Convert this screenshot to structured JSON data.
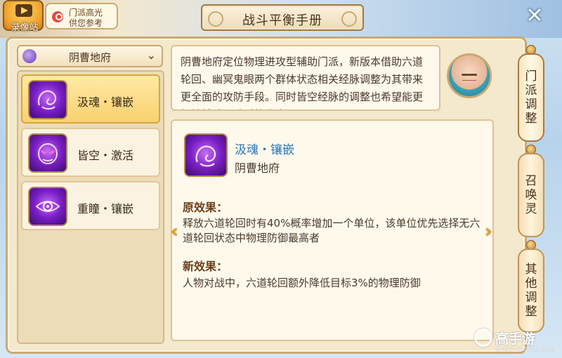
{
  "header": {
    "record_label": "录像站",
    "highlight_line1": "门派高光",
    "highlight_line2": "供您参考",
    "title": "战斗平衡手册",
    "close_symbol": "✕"
  },
  "school_select": {
    "label": "阴曹地府",
    "arrow": "⌄"
  },
  "skills": [
    {
      "name": "汲魂・镶嵌",
      "selected": true,
      "icon": "ghost-swirl-icon"
    },
    {
      "name": "皆空・激活",
      "selected": false,
      "icon": "demon-mask-icon"
    },
    {
      "name": "重瞳・镶嵌",
      "selected": false,
      "icon": "eye-vortex-icon"
    }
  ],
  "description": "阴曹地府定位物理进攻型辅助门派，新版本借助六道轮回、幽冥鬼眼两个群体状态相关经脉调整为其带来更全面的攻防手段。同时皆空经脉的调整也希望能更好地辅助团队对抗敌方",
  "detail": {
    "skill_name": "汲魂・镶嵌",
    "school": "阴曹地府",
    "original_title": "原效果：",
    "original_text": "释放六道轮回时有40%概率增加一个单位，该单位优先选择无六道轮回状态中物理防御最高者",
    "new_title": "新效果：",
    "new_text": "人物对战中，六道轮回额外降低目标3%的物理防御",
    "prev_arrow": "‹",
    "next_arrow": "›"
  },
  "side_tabs": [
    {
      "label": "门派调整",
      "active": true
    },
    {
      "label": "召唤灵",
      "active": false
    },
    {
      "label": "其他调整",
      "active": false
    }
  ],
  "watermark": {
    "text": "高手游",
    "sub": "GAOSHOUYOU.COM"
  }
}
